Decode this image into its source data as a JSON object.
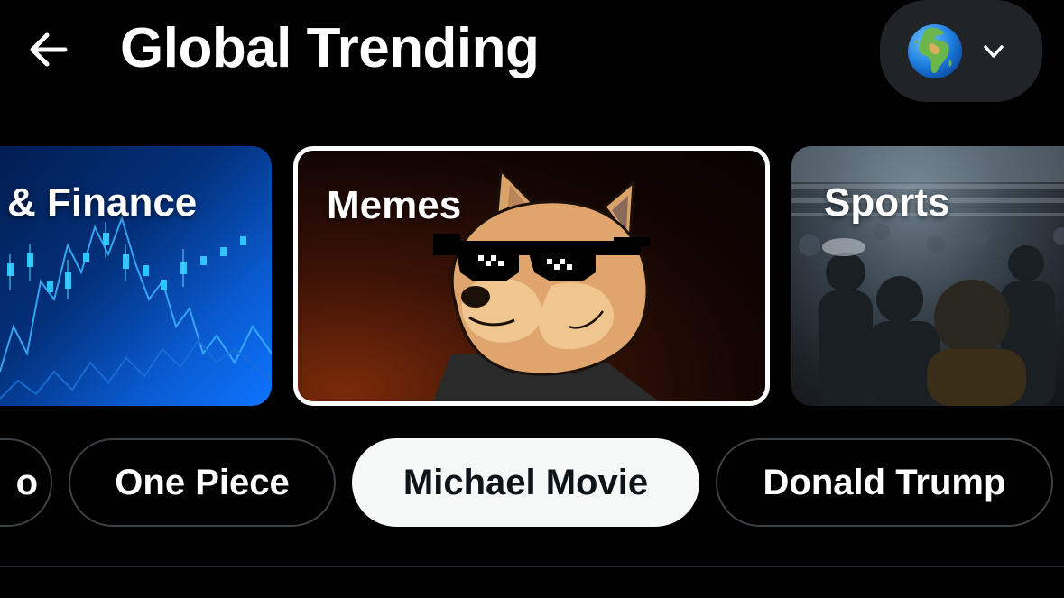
{
  "header": {
    "title": "Global Trending"
  },
  "region": {
    "icon": "globe-africa-europe-icon"
  },
  "categories": [
    {
      "label": "& Finance",
      "selected": false
    },
    {
      "label": "Memes",
      "selected": true
    },
    {
      "label": "Sports",
      "selected": false
    }
  ],
  "topics": [
    {
      "label": "o",
      "selected": false
    },
    {
      "label": "One Piece",
      "selected": false
    },
    {
      "label": "Michael Movie",
      "selected": true
    },
    {
      "label": "Donald Trump",
      "selected": false
    }
  ],
  "colors": {
    "background": "#000000",
    "selected_pill_bg": "#f7f9f9",
    "selected_pill_text": "#0f1419",
    "region_button_bg": "#202327",
    "pill_border": "#3e4144"
  }
}
